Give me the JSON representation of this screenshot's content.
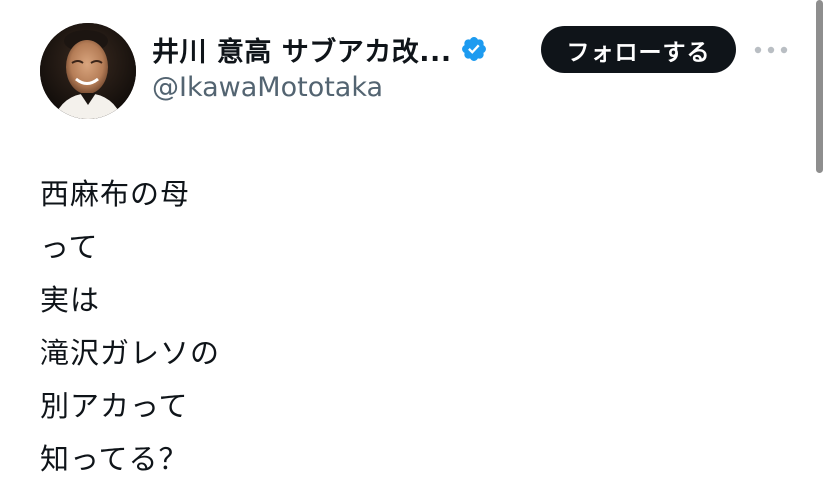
{
  "profile": {
    "display_name": "井川 意高 サブアカ改...",
    "handle": "@IkawaMototaka",
    "verified": true,
    "avatar_icon": "profile-photo"
  },
  "actions": {
    "follow_label": "フォローする",
    "more_icon": "ellipsis-icon"
  },
  "tweet": {
    "lines": [
      "西麻布の母",
      "って",
      "実は",
      "滝沢ガレソの",
      "別アカって",
      "知ってる？"
    ]
  },
  "colors": {
    "text": "#0f1419",
    "secondary_text": "#536471",
    "follow_button_bg": "#0f1419",
    "verified_badge": "#1d9bf0"
  }
}
